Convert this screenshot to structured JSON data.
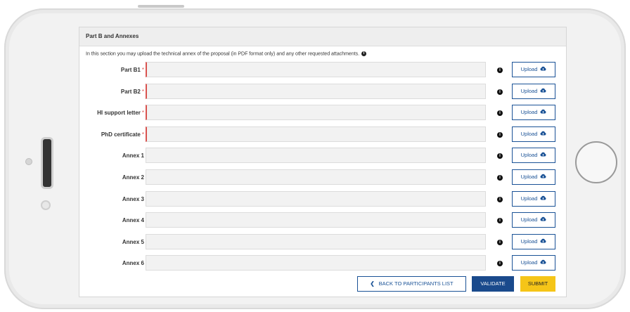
{
  "section": {
    "title": "Part B and Annexes",
    "intro": "In this section you may upload the technical annex of the proposal (in PDF format only) and any other requested attachments."
  },
  "upload_label": "Upload",
  "rows": [
    {
      "label": "Part B1",
      "required": true
    },
    {
      "label": "Part B2",
      "required": true
    },
    {
      "label": "HI support letter",
      "required": true
    },
    {
      "label": "PhD certificate",
      "required": true
    },
    {
      "label": "Annex 1",
      "required": false
    },
    {
      "label": "Annex 2",
      "required": false
    },
    {
      "label": "Annex 3",
      "required": false
    },
    {
      "label": "Annex 4",
      "required": false
    },
    {
      "label": "Annex 5",
      "required": false
    },
    {
      "label": "Annex 6",
      "required": false
    }
  ],
  "buttons": {
    "back": "BACK TO PARTICIPANTS LIST",
    "validate": "VALIDATE",
    "submit": "SUBMIT"
  },
  "icons": {
    "info": "info-icon",
    "upload": "cloud-upload-icon",
    "back": "chevron-left-icon"
  },
  "colors": {
    "primary": "#1a4a8c",
    "required": "#d9534f",
    "submit": "#f5c518"
  }
}
